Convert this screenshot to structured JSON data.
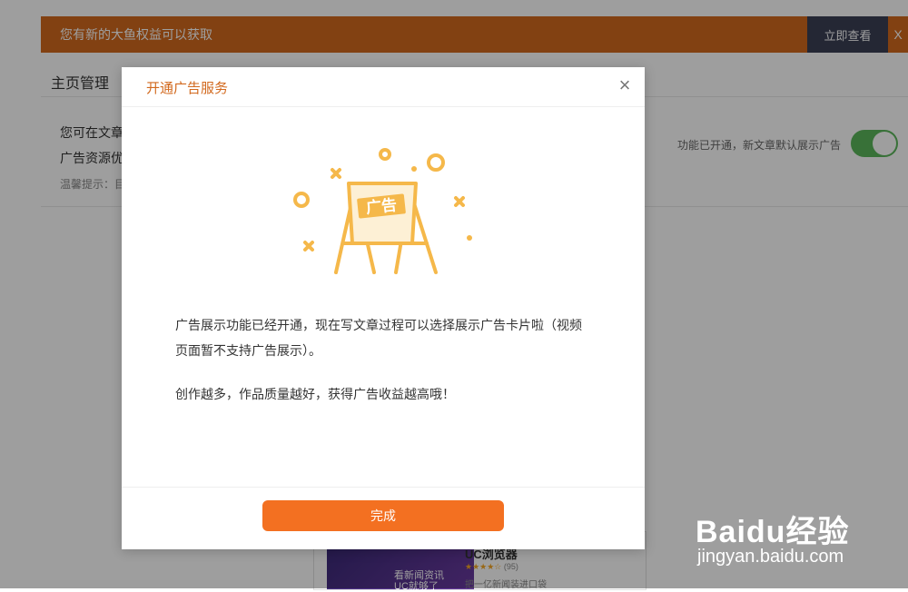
{
  "notice": {
    "text": "您有新的大鱼权益可以获取",
    "button_label": "立即查看",
    "close_label": "X"
  },
  "page": {
    "title": "主页管理",
    "ad_line1": "您可在文章",
    "ad_line2": "广告资源优",
    "tip": "温馨提示：目",
    "status_text": "功能已开通，新文章默认展示广告",
    "toggle_on": true
  },
  "promo": {
    "thumb_caption_line1": "看新闻资讯",
    "thumb_caption_line2": "UC就够了",
    "app_name": "UC浏览器",
    "stars": "★★★★☆",
    "rating": "(95)",
    "desc": "把一亿新闻装进口袋"
  },
  "modal": {
    "title": "开通广告服务",
    "close_label": "×",
    "illustration_label": "广告",
    "paragraph1": "广告展示功能已经开通，现在写文章过程可以选择展示广告卡片啦（视频页面暂不支持广告展示）。",
    "paragraph2": "创作越多，作品质量越好，获得广告收益越高哦！",
    "done_label": "完成"
  },
  "watermark": {
    "logo": "Baidu经验",
    "url": "jingyan.baidu.com"
  },
  "colors": {
    "notice_bg": "#d2691e",
    "accent": "#f37021",
    "illustration": "#f5b84a",
    "toggle_on": "#5bb75b"
  }
}
